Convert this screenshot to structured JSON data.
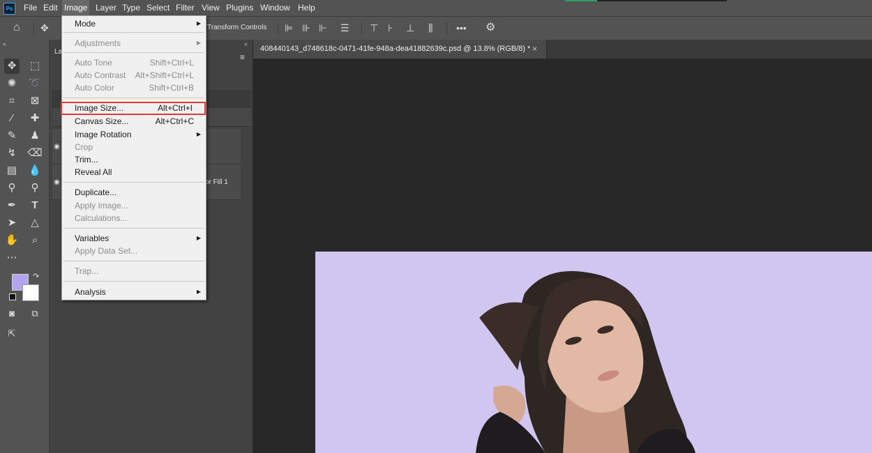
{
  "menubar": {
    "items": [
      {
        "label": "File"
      },
      {
        "label": "Edit"
      },
      {
        "label": "Image"
      },
      {
        "label": "Layer"
      },
      {
        "label": "Type"
      },
      {
        "label": "Select"
      },
      {
        "label": "Filter"
      },
      {
        "label": "View"
      },
      {
        "label": "Plugins"
      },
      {
        "label": "Window"
      },
      {
        "label": "Help"
      }
    ],
    "active": "Image",
    "logo": "Ps"
  },
  "options_bar": {
    "transform_controls_label": "Transform Controls"
  },
  "document": {
    "tab_title": "408440143_d748618c-0471-41fe-948a-dea41882639c.psd @ 13.8% (RGB/8) *",
    "close": "×"
  },
  "panel": {
    "tab_label": "La",
    "layer2_name": "or Fill 1"
  },
  "colors": {
    "foreground": "#b3a4f2",
    "background": "#ffffff",
    "canvas_fill": "#d0c6ef"
  },
  "image_menu": {
    "mode": "Mode",
    "adjustments": "Adjustments",
    "auto_tone": "Auto Tone",
    "auto_tone_sc": "Shift+Ctrl+L",
    "auto_contrast": "Auto Contrast",
    "auto_contrast_sc": "Alt+Shift+Ctrl+L",
    "auto_color": "Auto Color",
    "auto_color_sc": "Shift+Ctrl+B",
    "image_size": "Image Size...",
    "image_size_sc": "Alt+Ctrl+I",
    "canvas_size": "Canvas Size...",
    "canvas_size_sc": "Alt+Ctrl+C",
    "image_rotation": "Image Rotation",
    "crop": "Crop",
    "trim": "Trim...",
    "reveal_all": "Reveal All",
    "duplicate": "Duplicate...",
    "apply_image": "Apply Image...",
    "calculations": "Calculations...",
    "variables": "Variables",
    "apply_data_set": "Apply Data Set...",
    "trap": "Trap...",
    "analysis": "Analysis"
  }
}
